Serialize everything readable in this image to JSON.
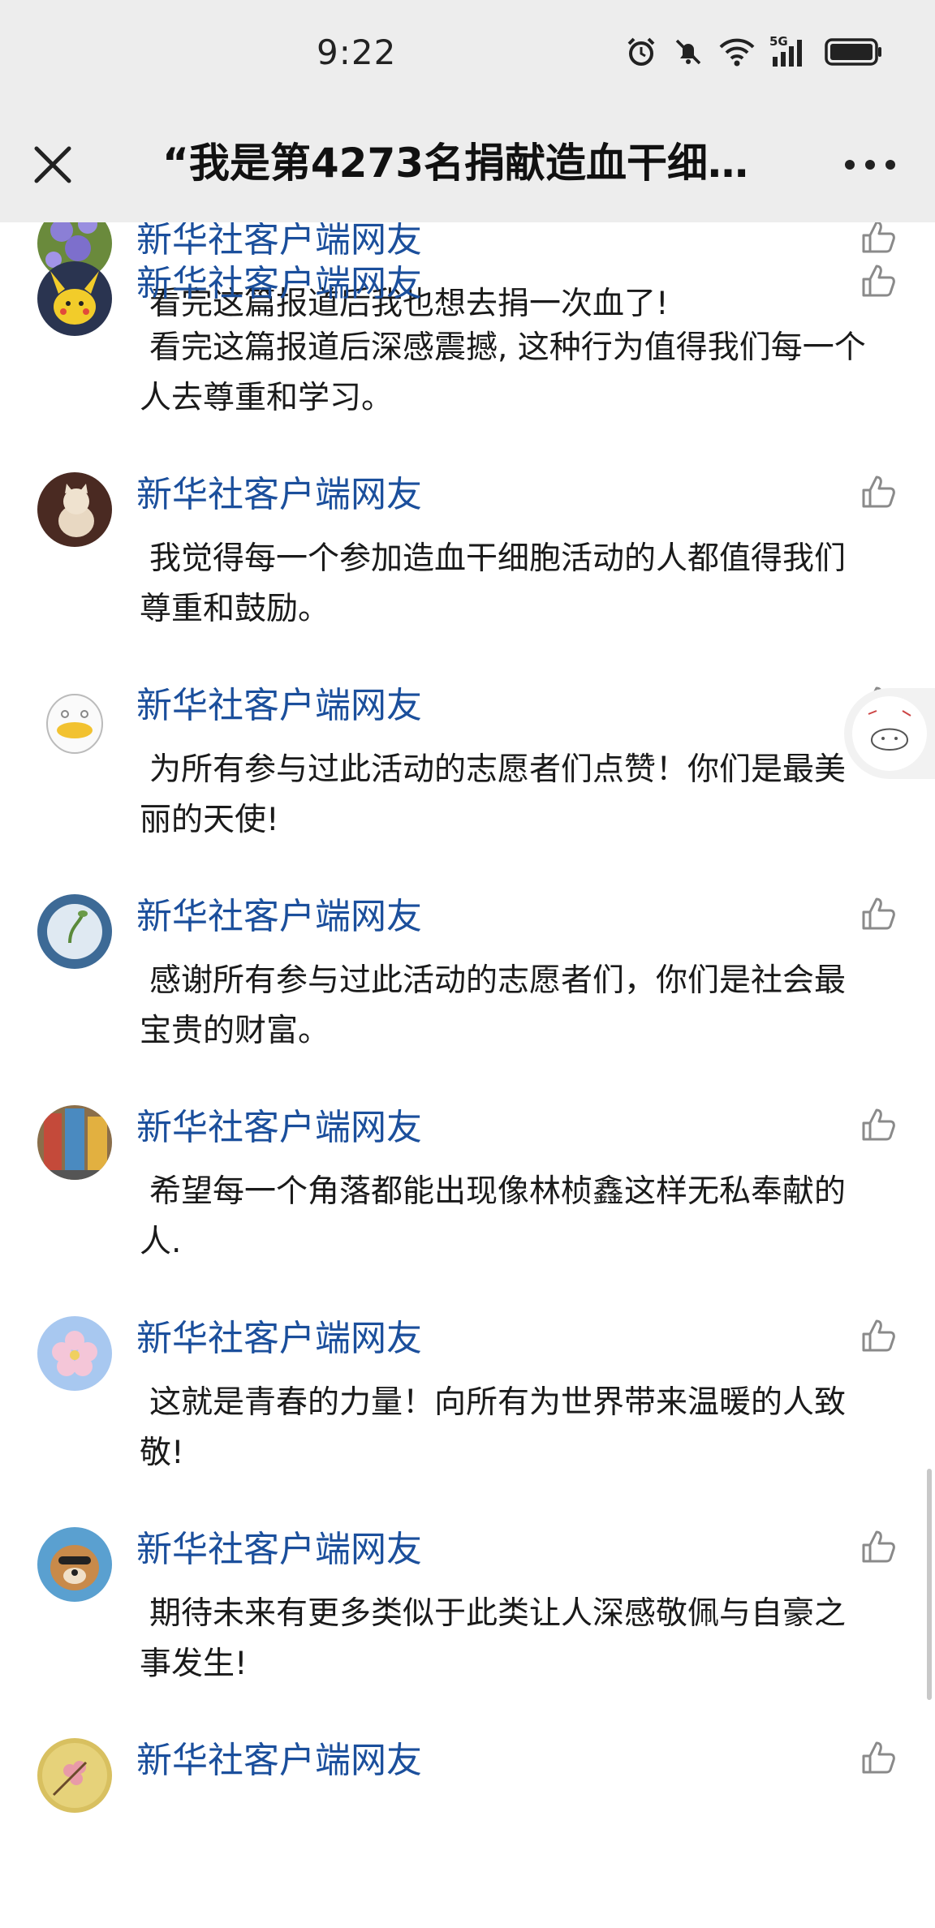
{
  "status_bar": {
    "time": "9:22",
    "network_label": "5G"
  },
  "header": {
    "title": "“我是第4273名捐献造血干细…"
  },
  "comments": [
    {
      "author": "新华社客户端网友",
      "text": "看完这篇报道后我也想去捐一次血了!",
      "avatar_icon": "flower-avatar-icon"
    },
    {
      "author": "新华社客户端网友",
      "text": "看完这篇报道后深感震撼, 这种行为值得我们每一个人去尊重和学习。",
      "avatar_icon": "pikachu-avatar-icon"
    },
    {
      "author": "新华社客户端网友",
      "text": "我觉得每一个参加造血干细胞活动的人都值得我们尊重和鼓励。",
      "avatar_icon": "cat-avatar-icon"
    },
    {
      "author": "新华社客户端网友",
      "text": "为所有参与过此活动的志愿者们点赞！你们是最美丽的天使!",
      "avatar_icon": "duck-avatar-icon"
    },
    {
      "author": "新华社客户端网友",
      "text": "感谢所有参与过此活动的志愿者们，你们是社会最宝贵的财富。",
      "avatar_icon": "bowl-avatar-icon"
    },
    {
      "author": "新华社客户端网友",
      "text": "希望每一个角落都能出现像林桢鑫这样无私奉献的人.",
      "avatar_icon": "street-avatar-icon"
    },
    {
      "author": "新华社客户端网友",
      "text": "这就是青春的力量！向所有为世界带来温暖的人致敬!",
      "avatar_icon": "blossom-avatar-icon"
    },
    {
      "author": "新华社客户端网友",
      "text": "期待未来有更多类似于此类让人深感敬佩与自豪之事发生!",
      "avatar_icon": "dog-avatar-icon"
    },
    {
      "author": "新华社客户端网友",
      "text": "",
      "avatar_icon": "peach-blossom-avatar-icon"
    }
  ],
  "colors": {
    "author": "#1b4f9c",
    "header_bg": "#ededed"
  }
}
